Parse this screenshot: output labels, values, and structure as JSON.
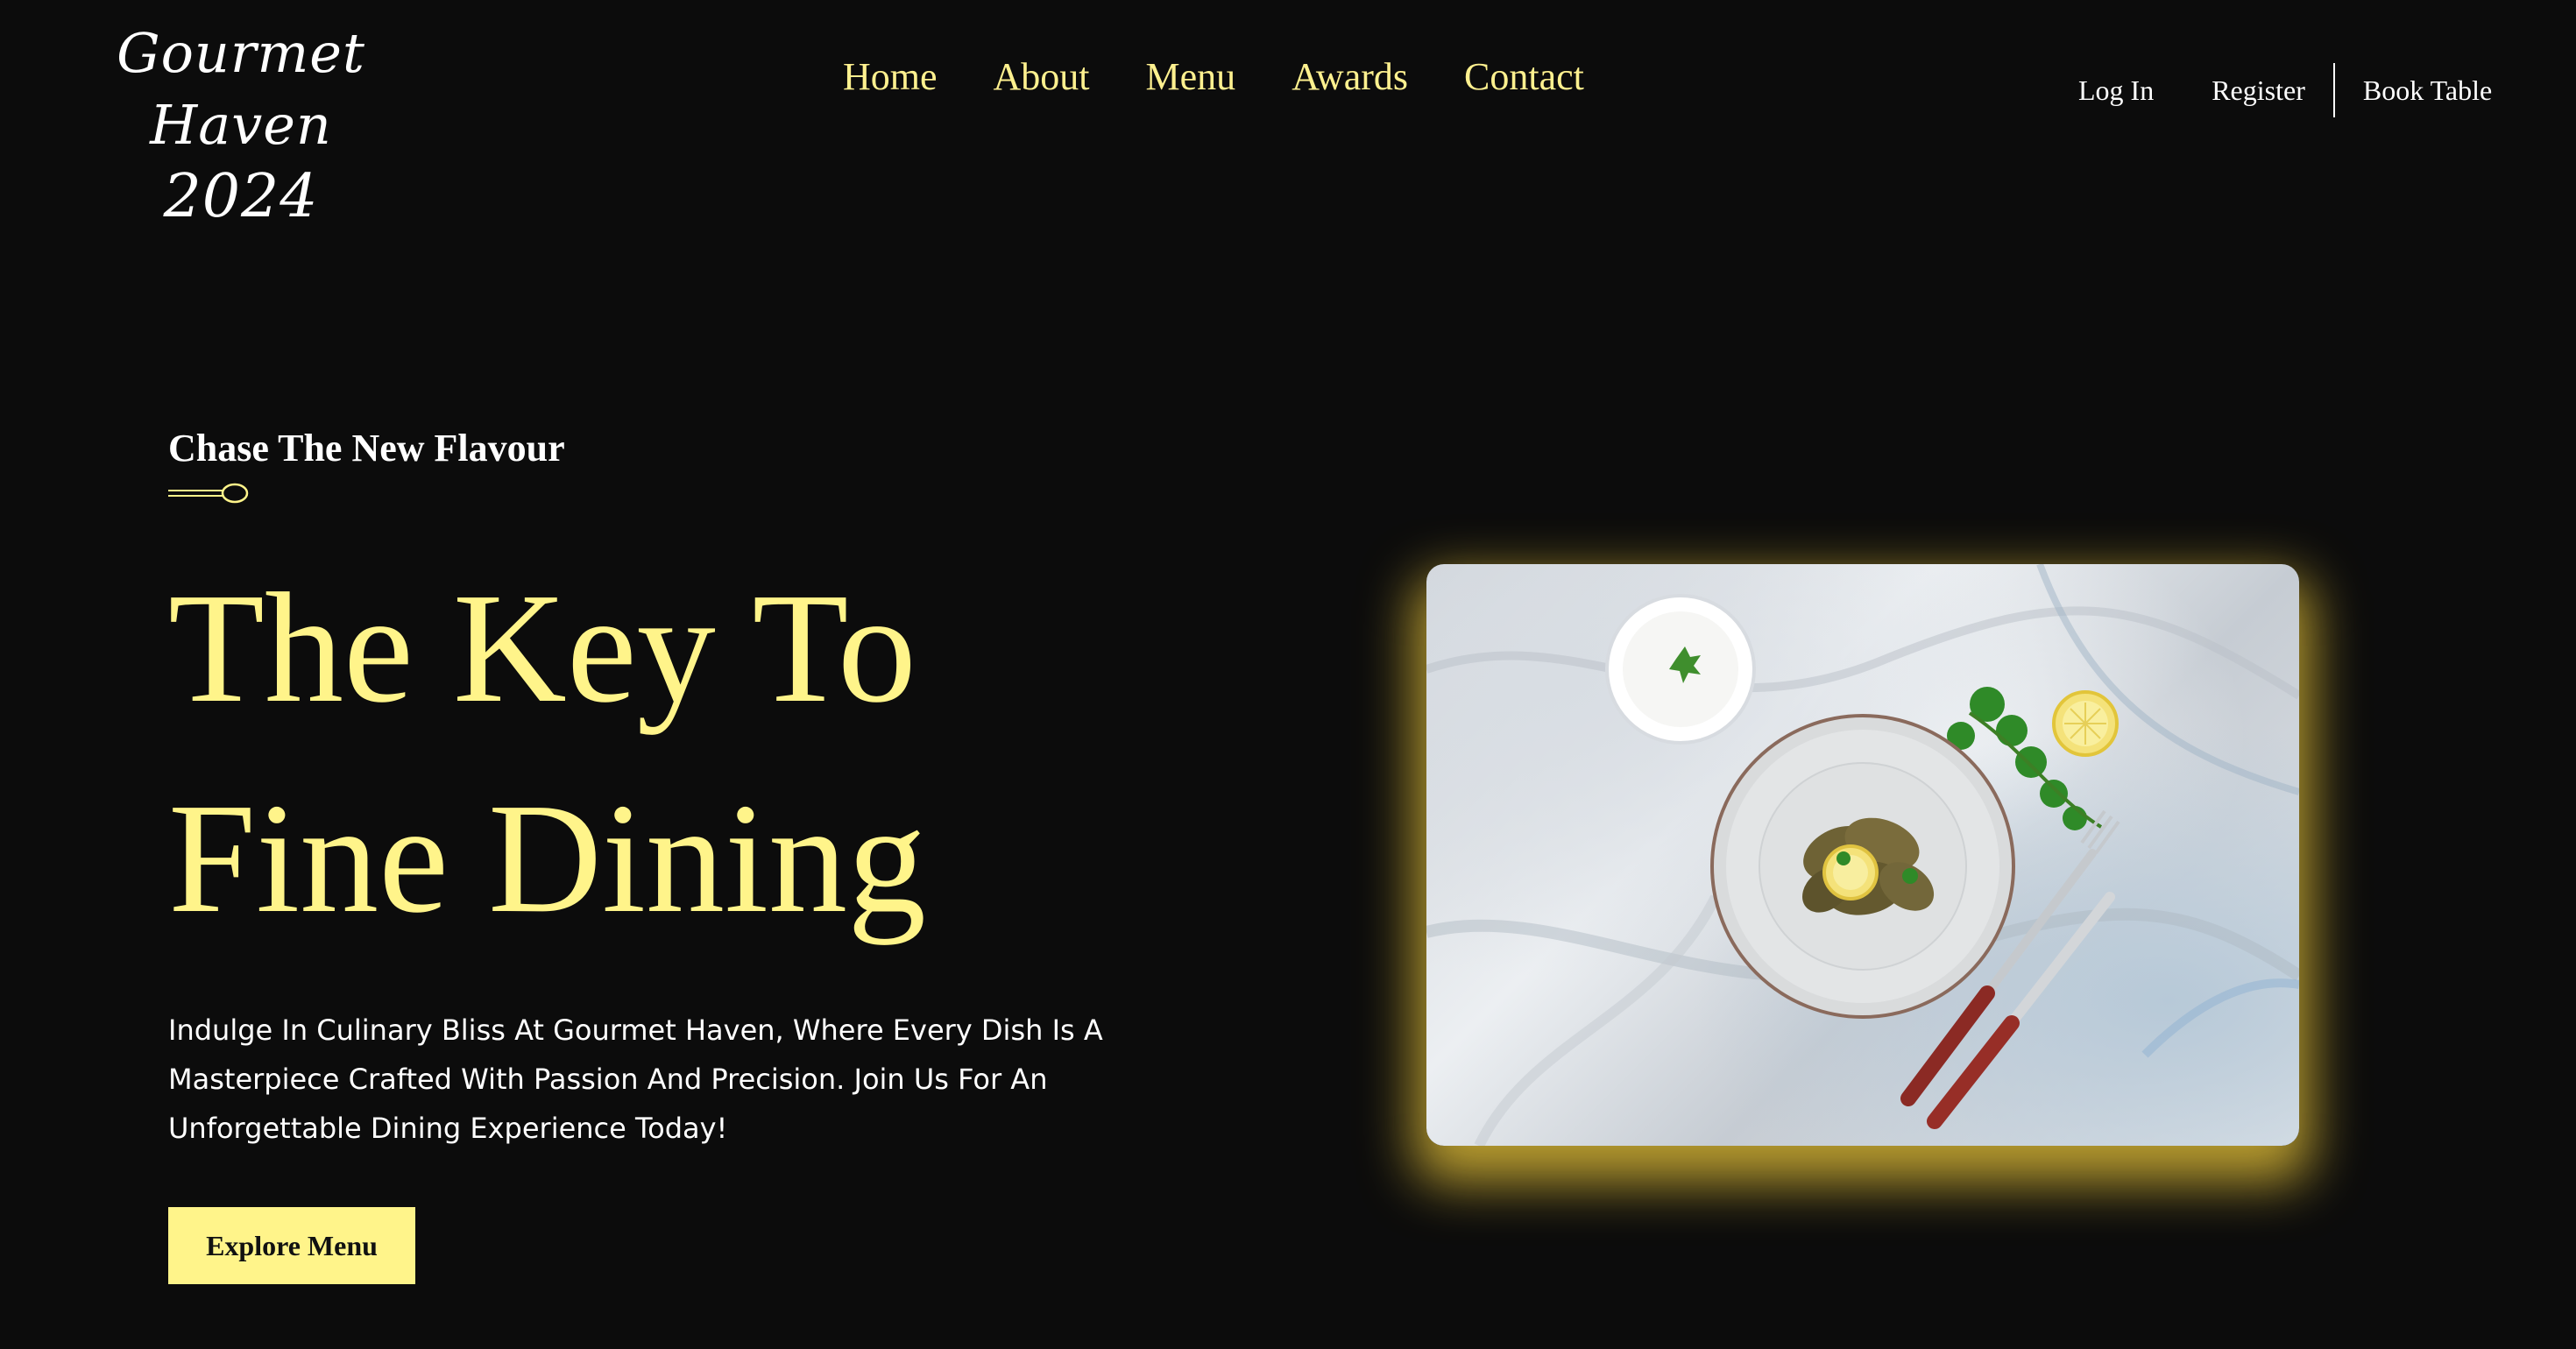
{
  "brand": {
    "name": "Gourmet Haven",
    "year": "2024"
  },
  "nav": {
    "items": [
      {
        "label": "Home"
      },
      {
        "label": "About"
      },
      {
        "label": "Menu"
      },
      {
        "label": "Awards"
      },
      {
        "label": "Contact"
      }
    ]
  },
  "user_nav": {
    "login": "Log In",
    "register": "Register",
    "book": "Book Table"
  },
  "hero": {
    "eyebrow": "Chase The New Flavour",
    "headline_line1": "The Key To",
    "headline_line2": "Fine Dining",
    "description": "Indulge In Culinary Bliss At Gourmet Haven, Where Every Dish Is A Masterpiece Crafted With Passion And Precision. Join Us For An Unforgettable Dining Experience Today!",
    "cta_label": "Explore Menu"
  },
  "colors": {
    "background": "#0c0c0c",
    "accent": "#fff48a",
    "glow": "#e8c43a",
    "text": "#ffffff"
  },
  "icons": {
    "ornament": "spoon-icon"
  }
}
